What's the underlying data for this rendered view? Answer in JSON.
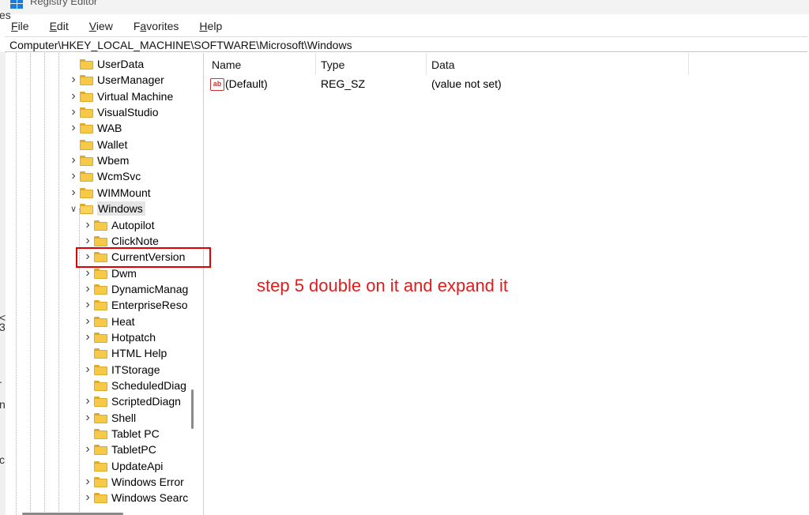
{
  "window": {
    "title": "Registry Editor"
  },
  "menu": [
    {
      "accel": "F",
      "rest": "ile"
    },
    {
      "accel": "E",
      "rest": "dit"
    },
    {
      "accel": "V",
      "rest": "iew"
    },
    {
      "pre": "F",
      "accel": "a",
      "rest": "vorites"
    },
    {
      "accel": "H",
      "rest": "elp"
    }
  ],
  "address": "Computer\\HKEY_LOCAL_MACHINE\\SOFTWARE\\Microsoft\\Windows",
  "left_edge_fragments": [
    "es",
    "<",
    "3",
    ".",
    "n",
    "c"
  ],
  "tree_level1": [
    {
      "label": "UserData",
      "expand": "none"
    },
    {
      "label": "UserManager",
      "expand": "collapsed"
    },
    {
      "label": "Virtual Machine",
      "expand": "collapsed"
    },
    {
      "label": "VisualStudio",
      "expand": "collapsed"
    },
    {
      "label": "WAB",
      "expand": "collapsed"
    },
    {
      "label": "Wallet",
      "expand": "none"
    },
    {
      "label": "Wbem",
      "expand": "collapsed"
    },
    {
      "label": "WcmSvc",
      "expand": "collapsed"
    },
    {
      "label": "WIMMount",
      "expand": "collapsed"
    },
    {
      "label": "Windows",
      "expand": "expanded",
      "selected": true
    }
  ],
  "tree_level2": [
    {
      "label": "Autopilot",
      "expand": "collapsed"
    },
    {
      "label": "ClickNote",
      "expand": "collapsed"
    },
    {
      "label": "CurrentVersion",
      "expand": "collapsed",
      "highlighted": true
    },
    {
      "label": "Dwm",
      "expand": "collapsed"
    },
    {
      "label": "DynamicManag",
      "expand": "collapsed"
    },
    {
      "label": "EnterpriseReso",
      "expand": "collapsed"
    },
    {
      "label": "Heat",
      "expand": "collapsed"
    },
    {
      "label": "Hotpatch",
      "expand": "collapsed"
    },
    {
      "label": "HTML Help",
      "expand": "none"
    },
    {
      "label": "ITStorage",
      "expand": "collapsed"
    },
    {
      "label": "ScheduledDiag",
      "expand": "none"
    },
    {
      "label": "ScriptedDiagn",
      "expand": "collapsed"
    },
    {
      "label": "Shell",
      "expand": "collapsed"
    },
    {
      "label": "Tablet PC",
      "expand": "none"
    },
    {
      "label": "TabletPC",
      "expand": "collapsed"
    },
    {
      "label": "UpdateApi",
      "expand": "none"
    },
    {
      "label": "Windows Error",
      "expand": "collapsed"
    },
    {
      "label": "Windows Searc",
      "expand": "collapsed"
    }
  ],
  "columns": [
    "Name",
    "Type",
    "Data"
  ],
  "values": [
    {
      "icon": "ab",
      "name": "(Default)",
      "type": "REG_SZ",
      "data": "(value not set)"
    }
  ],
  "annotation": "step 5 double on it and expand it",
  "colors": {
    "annotation": "#e31b1b",
    "folder": "#f7c948",
    "highlight_box": "#e00000"
  }
}
